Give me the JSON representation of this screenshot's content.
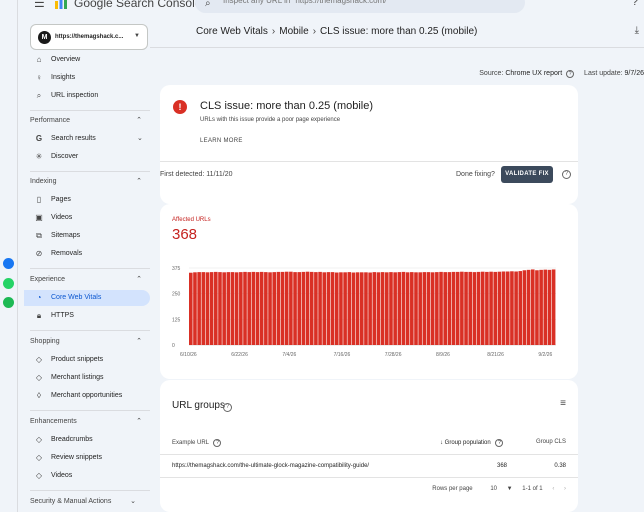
{
  "app": {
    "name": "Google Search Console",
    "search_placeholder": "Inspect any URL in \"https://themagshack.com/\""
  },
  "dock": {
    "icons": [
      "messenger-icon",
      "whatsapp-icon",
      "spotify-icon"
    ],
    "colors": [
      "#1877f2",
      "#25d366",
      "#1db954"
    ]
  },
  "property": {
    "name": "https://themagshack.c...",
    "initial": "M"
  },
  "sidebar": {
    "top": [
      {
        "label": "Overview",
        "icon": "home-icon"
      },
      {
        "label": "Insights",
        "icon": "insights-icon"
      },
      {
        "label": "URL inspection",
        "icon": "search-icon"
      }
    ],
    "performance": {
      "title": "Performance",
      "items": [
        {
          "label": "Search results",
          "icon": "google-g-icon"
        },
        {
          "label": "Discover",
          "icon": "asterisk-icon"
        }
      ]
    },
    "indexing": {
      "title": "Indexing",
      "items": [
        {
          "label": "Pages",
          "icon": "pages-icon"
        },
        {
          "label": "Videos",
          "icon": "videos-icon"
        },
        {
          "label": "Sitemaps",
          "icon": "sitemap-icon"
        },
        {
          "label": "Removals",
          "icon": "removals-icon"
        }
      ]
    },
    "experience": {
      "title": "Experience",
      "items": [
        {
          "label": "Core Web Vitals",
          "icon": "gauge-icon"
        },
        {
          "label": "HTTPS",
          "icon": "lock-icon"
        }
      ]
    },
    "shopping": {
      "title": "Shopping",
      "items": [
        {
          "label": "Product snippets",
          "icon": "diamond-icon"
        },
        {
          "label": "Merchant listings",
          "icon": "diamond-icon"
        },
        {
          "label": "Merchant opportunities",
          "icon": "tag-icon"
        }
      ]
    },
    "enhancements": {
      "title": "Enhancements",
      "items": [
        {
          "label": "Breadcrumbs",
          "icon": "diamond-icon"
        },
        {
          "label": "Review snippets",
          "icon": "diamond-icon"
        },
        {
          "label": "Videos",
          "icon": "diamond-icon"
        }
      ]
    },
    "security": {
      "title": "Security & Manual Actions"
    }
  },
  "breadcrumb": [
    "Core Web Vitals",
    "Mobile",
    "CLS issue: more than 0.25 (mobile)"
  ],
  "source": {
    "label": "Source:",
    "value": "Chrome UX report",
    "updated_label": "Last update:",
    "updated_value": "9/7/26"
  },
  "issue": {
    "title": "CLS issue: more than 0.25 (mobile)",
    "subtitle": "URLs with this issue provide a poor page experience",
    "learn_more": "LEARN MORE",
    "first_detected": "First detected: 11/11/20",
    "done_fixing": "Done fixing?",
    "validate": "VALIDATE FIX"
  },
  "affected": {
    "label": "Affected URLs",
    "value": "368"
  },
  "chart_data": {
    "type": "bar",
    "title": "Affected URLs",
    "ylim": [
      0,
      375
    ],
    "yticks": [
      0,
      125,
      250,
      375
    ],
    "xticks": [
      "6/10/26",
      "6/22/26",
      "7/4/26",
      "7/16/26",
      "7/28/26",
      "8/9/26",
      "8/21/26",
      "9/2/26"
    ],
    "bar_color": "#d93025",
    "values": [
      352,
      354,
      355,
      355,
      354,
      355,
      356,
      355,
      354,
      355,
      355,
      354,
      355,
      356,
      355,
      356,
      355,
      356,
      355,
      354,
      355,
      356,
      356,
      357,
      357,
      355,
      355,
      356,
      357,
      356,
      355,
      356,
      354,
      355,
      355,
      353,
      354,
      354,
      355,
      353,
      354,
      354,
      354,
      353,
      355,
      354,
      355,
      354,
      355,
      354,
      355,
      356,
      354,
      355,
      354,
      354,
      355,
      355,
      354,
      355,
      356,
      355,
      355,
      356,
      356,
      357,
      356,
      356,
      355,
      356,
      357,
      356,
      357,
      356,
      357,
      358,
      358,
      359,
      358,
      360,
      364,
      366,
      368,
      364,
      366,
      367,
      366,
      368
    ]
  },
  "groups": {
    "title": "URL groups",
    "headers": [
      "Example URL",
      "Group population",
      "Group CLS"
    ],
    "rows": [
      {
        "url": "https://themagshack.com/the-ultimate-glock-magazine-compatibility-guide/",
        "population": "368",
        "cls": "0.38"
      }
    ],
    "rows_per_page_label": "Rows per page",
    "rows_per_page": "10",
    "range": "1-1 of 1"
  }
}
